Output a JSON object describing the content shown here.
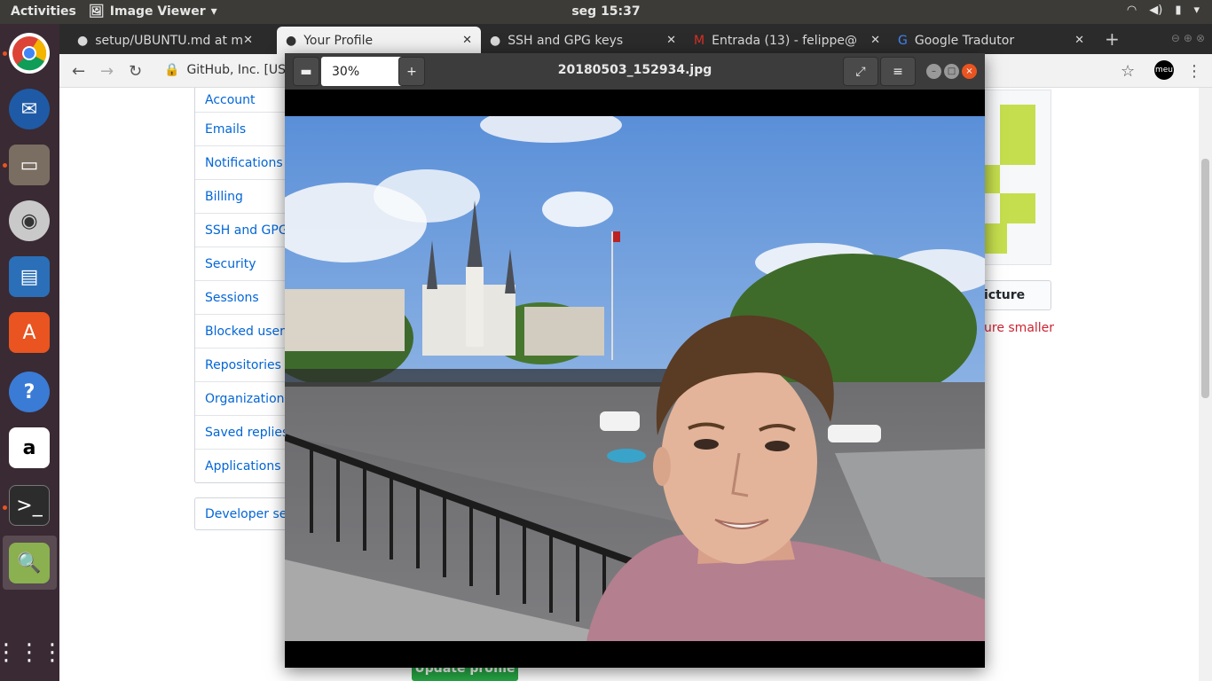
{
  "topbar": {
    "activities": "Activities",
    "app_menu": "Image Viewer",
    "clock": "seg 15:37"
  },
  "browser": {
    "tabs": [
      {
        "label": "setup/UBUNTU.md at m"
      },
      {
        "label": "Your Profile"
      },
      {
        "label": "SSH and GPG keys"
      },
      {
        "label": "Entrada (13) - felippe@"
      },
      {
        "label": "Google Tradutor"
      }
    ],
    "url_label": "GitHub, Inc. [US]"
  },
  "settings_menu": {
    "items": [
      "Account",
      "Emails",
      "Notifications",
      "Billing",
      "SSH and GPG",
      "Security",
      "Sessions",
      "Blocked users",
      "Repositories",
      "Organizations",
      "Saved replies",
      "Applications"
    ],
    "developer": "Developer sett"
  },
  "profile": {
    "edit_picture": "icture",
    "note": "ure smaller",
    "update_button": "Update profile"
  },
  "viewer": {
    "zoom": "30%",
    "filename": "20180503_152934.jpg"
  },
  "colors": {
    "accent": "#e95420",
    "link": "#0366d6",
    "viewer_header": "#3c3c3c"
  }
}
